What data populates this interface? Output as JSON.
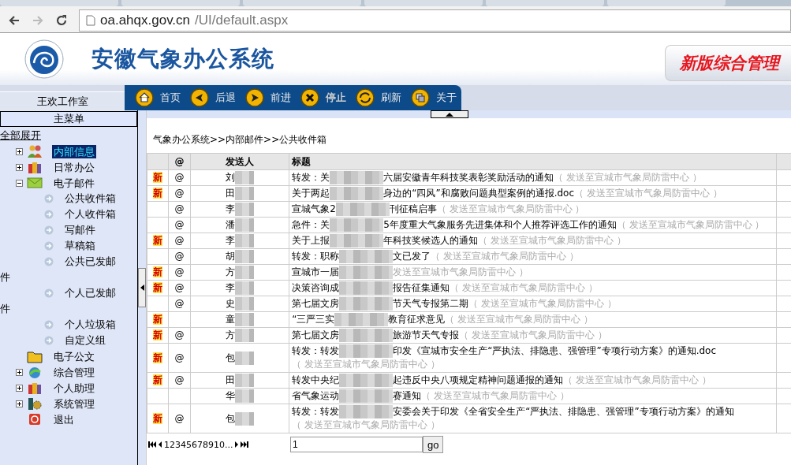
{
  "browser": {
    "url_host": "oa.ahqx.gov.cn",
    "url_path": "/UI/default.aspx"
  },
  "header": {
    "title": "安徽气象办公系统",
    "banner": "新版综合管理"
  },
  "nav": {
    "workspace": "王欢工作室",
    "buttons": [
      {
        "kind": "home",
        "label": "首页"
      },
      {
        "kind": "back",
        "label": "后退"
      },
      {
        "kind": "forward",
        "label": "前进"
      },
      {
        "kind": "stop",
        "label": "停止"
      },
      {
        "kind": "refresh",
        "label": "刷新"
      },
      {
        "kind": "about",
        "label": "关于"
      }
    ]
  },
  "sidebar": {
    "header": "主菜单",
    "expand_all": "全部展开",
    "items": [
      {
        "label": "内部信息",
        "expanded": false,
        "selected": true
      },
      {
        "label": "日常办公",
        "expanded": false,
        "selected": false
      },
      {
        "label": "电子邮件",
        "expanded": true,
        "selected": false,
        "children": [
          {
            "label": "公共收件箱",
            "selected": false
          },
          {
            "label": "个人收件箱",
            "selected": false
          },
          {
            "label": "写邮件",
            "selected": false
          },
          {
            "label": "草稿箱",
            "selected": false
          },
          {
            "label": "公共已发邮件",
            "selected": false
          },
          {
            "label": "个人已发邮件",
            "selected": false
          },
          {
            "label": "个人垃圾箱",
            "selected": false
          },
          {
            "label": "自定义组",
            "selected": false
          }
        ]
      },
      {
        "label": "电子公文",
        "selected": false
      },
      {
        "label": "综合管理",
        "expanded": false,
        "selected": false
      },
      {
        "label": "个人助理",
        "expanded": false,
        "selected": false
      },
      {
        "label": "系统管理",
        "expanded": false,
        "selected": false
      },
      {
        "label": "退出",
        "selected": false
      }
    ]
  },
  "breadcrumb": "气象办公系统>>内部邮件>>公共收件箱",
  "table": {
    "columns": [
      "@",
      "发送人",
      "标题"
    ],
    "rows": [
      {
        "badge": "新",
        "at": "@",
        "sender": "刘",
        "title_start": "转发：关",
        "title_end": "六届安徽青年科技奖表彰奖励活动的通知",
        "note": "（ 发送至宣城市气象局防雷中心 ）"
      },
      {
        "badge": "新",
        "at": "@",
        "sender": "田",
        "title_start": "关于两起",
        "title_end": "身边的“四风”和腐败问题典型案例的通报.doc",
        "note": "（ 发送至宣城市气象局防雷中心 ）"
      },
      {
        "at": "@",
        "sender": "李",
        "title_start": "宣城气象2",
        "title_end": "刊征稿启事",
        "note": "（ 发送至宣城市气象局防雷中心 ）"
      },
      {
        "at": "@",
        "sender": "潘",
        "title_start": "急件：关",
        "title_end": "5年度重大气象服务先进集体和个人推荐评选工作的通知",
        "note": "（ 发送至宣城市气象局防雷中心 ）"
      },
      {
        "badge": "新",
        "at": "@",
        "sender": "李",
        "title_start": "关于上报",
        "title_end": "年科技奖候选人的通知",
        "note": "（ 发送至宣城市气象局防雷中心 ）"
      },
      {
        "at": "@",
        "sender": "胡",
        "title_start": "转发：职称",
        "title_end": "文已发了",
        "note": "（ 发送至宣城市气象局防雷中心 ）"
      },
      {
        "badge": "新",
        "at": "@",
        "sender": "方",
        "title_start": "宣城市一届",
        "title_end": "",
        "note": "发送至宣城市气象局防雷中心 ）"
      },
      {
        "badge": "新",
        "at": "@",
        "sender": "李",
        "title_start": "决策咨询成",
        "title_end": "报告征集通知",
        "note": "（ 发送至宣城市气象局防雷中心 ）"
      },
      {
        "at": "@",
        "sender": "史",
        "title_start": "第七届文房",
        "title_end": "节天气专报第二期",
        "note": "（ 发送至宣城市气象局防雷中心 ）"
      },
      {
        "badge": "新",
        "sender": "童",
        "title_start": "“三严三实",
        "title_end": "教育征求意见",
        "note": "（ 发送至宣城市气象局防雷中心 ）"
      },
      {
        "badge": "新",
        "at": "@",
        "sender": "方",
        "title_start": "第七届文房",
        "title_end": "旅游节天气专报",
        "note": "（ 发送至宣城市气象局防雷中心 ）"
      },
      {
        "badge": "新",
        "at": "@",
        "sender": "包",
        "title_start": "转发：转发",
        "title_end": "印发《宣城市安全生产“严执法、排隐患、强管理”专项行动方案》的通知.doc",
        "note": "（ 发送至宣城市气象局防雷中心 ）"
      },
      {
        "badge": "新",
        "at": "@",
        "sender": "田",
        "title_start": "转发中央纪",
        "title_end": "起违反中央八项规定精神问题通报的通知",
        "note": "（ 发送至宣城市气象局防雷中心 ）"
      },
      {
        "sender": "华",
        "title_start": "省气象运动",
        "title_end": "赛通知",
        "note": "（ 发送至宣城市气象局防雷中心 ）"
      },
      {
        "badge": "新",
        "at": "@",
        "sender": "包",
        "title_start": "转发：转发",
        "title_end": "安委会关于印发《全省安全生产“严执法、排隐患、强管理”专项行动方案》的通知",
        "note": "（ 发送至宣城市气象局防雷中心 ）"
      }
    ]
  },
  "pager": {
    "pages": "12345678910...",
    "page_input": "1",
    "go": "go"
  }
}
